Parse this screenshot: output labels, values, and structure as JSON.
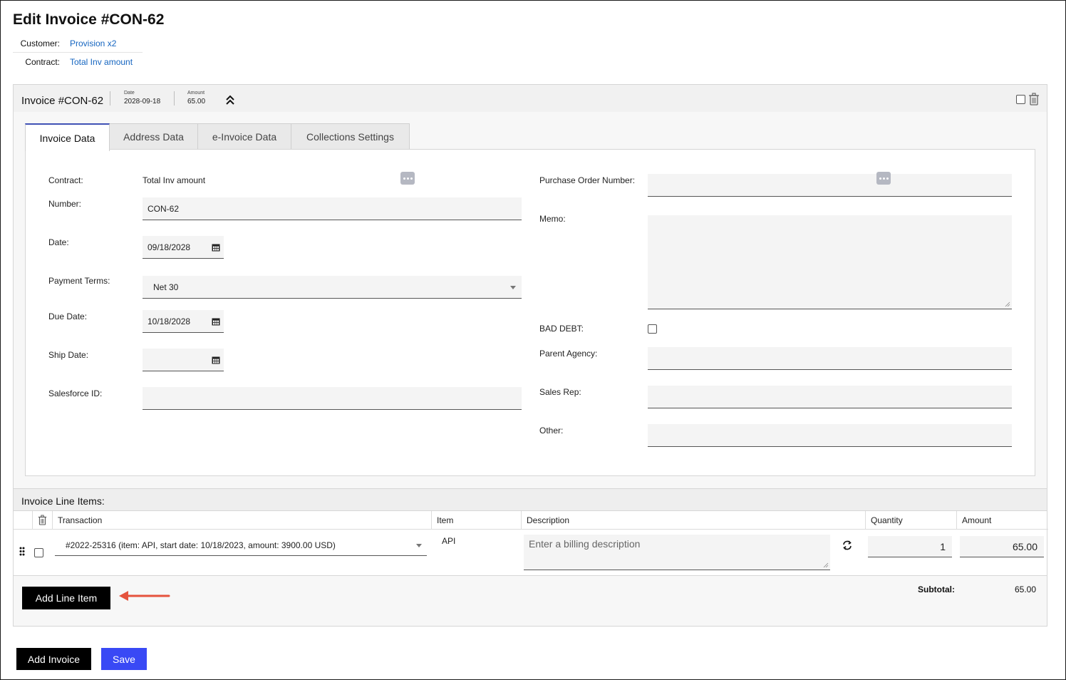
{
  "page": {
    "title": "Edit Invoice #CON-62",
    "customer_label": "Customer:",
    "customer_value": "Provision x2",
    "contract_label": "Contract:",
    "contract_value": "Total Inv amount"
  },
  "invoice_header": {
    "title": "Invoice #CON-62",
    "date_label": "Date",
    "date_value": "2028-09-18",
    "amount_label": "Amount",
    "amount_value": "65.00"
  },
  "tabs": [
    {
      "label": "Invoice Data",
      "active": true
    },
    {
      "label": "Address Data",
      "active": false
    },
    {
      "label": "e-Invoice Data",
      "active": false
    },
    {
      "label": "Collections Settings",
      "active": false
    }
  ],
  "form_left": {
    "contract_label": "Contract:",
    "contract_value": "Total Inv amount",
    "number_label": "Number:",
    "number_value": "CON-62",
    "date_label": "Date:",
    "date_value": "09/18/2028",
    "payment_terms_label": "Payment Terms:",
    "payment_terms_value": "Net 30",
    "due_date_label": "Due Date:",
    "due_date_value": "10/18/2028",
    "ship_date_label": "Ship Date:",
    "ship_date_value": "",
    "salesforce_label": "Salesforce ID:",
    "salesforce_value": ""
  },
  "form_right": {
    "po_label": "Purchase Order Number:",
    "po_value": "",
    "memo_label": "Memo:",
    "memo_value": "",
    "bad_debt_label": "BAD DEBT:",
    "bad_debt_checked": false,
    "parent_agency_label": "Parent Agency:",
    "parent_agency_value": "",
    "sales_rep_label": "Sales Rep:",
    "sales_rep_value": "",
    "other_label": "Other:",
    "other_value": ""
  },
  "line_items": {
    "title": "Invoice Line Items:",
    "columns": [
      "Transaction",
      "Item",
      "Description",
      "Quantity",
      "Amount"
    ],
    "rows": [
      {
        "transaction": "#2022-25316 (item: API, start date: 10/18/2023, amount: 3900.00 USD)",
        "item": "API",
        "description_placeholder": "Enter a billing description",
        "quantity": "1",
        "amount": "65.00"
      }
    ],
    "add_button": "Add Line Item",
    "subtotal_label": "Subtotal:",
    "subtotal_value": "65.00"
  },
  "footer": {
    "add_invoice": "Add Invoice",
    "save": "Save"
  },
  "colors": {
    "link": "#1565c0",
    "primary_blue": "#3949f5",
    "active_tab": "#3f51b5",
    "arrow": "#e5533d"
  }
}
